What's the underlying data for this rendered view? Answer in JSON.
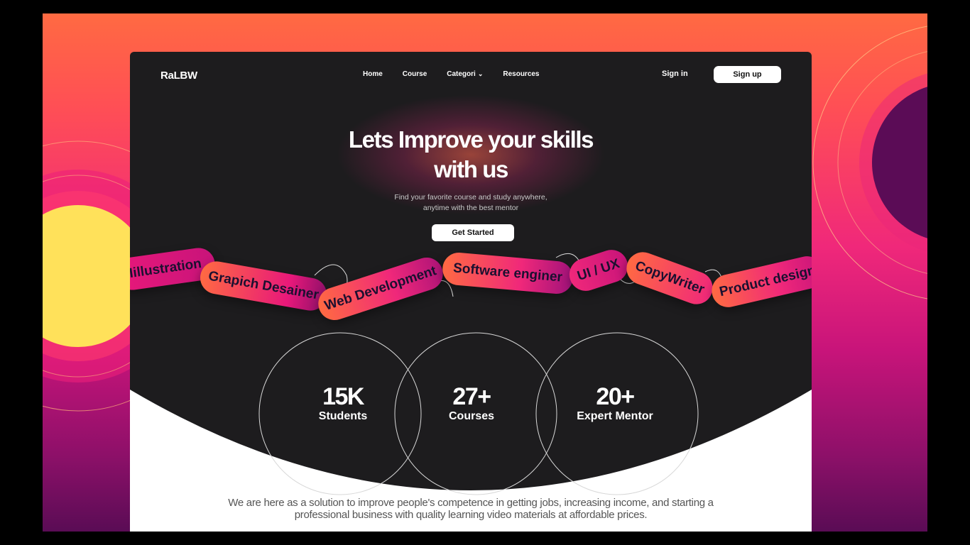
{
  "brand": {
    "logo": "RaLBW"
  },
  "nav": {
    "links": [
      "Home",
      "Course",
      "Categori",
      "Resources"
    ],
    "signin": "Sign in",
    "signup": "Sign up"
  },
  "hero": {
    "title_line1": "Lets Improve your skills",
    "title_line2": "with us",
    "subtitle_line1": "Find your favorite course and study anywhere,",
    "subtitle_line2": "anytime with the best mentor",
    "cta": "Get Started"
  },
  "categories": [
    "Iillustration",
    "Grapich Desainer",
    "Web Development",
    "Software enginer",
    "UI / UX",
    "CopyWriter",
    "Product design"
  ],
  "stats": [
    {
      "value": "15K",
      "label": "Students"
    },
    {
      "value": "27+",
      "label": "Courses"
    },
    {
      "value": "20+",
      "label": "Expert Mentor"
    }
  ],
  "mission": {
    "line1": "We are here as a solution to improve people's competence in getting jobs, increasing income, and starting a",
    "line2": "professional business with quality learning video materials at affordable prices."
  },
  "colors": {
    "accent_orange": "#ff6a42",
    "accent_pink": "#e8187a",
    "dark_bg": "#1d1c1e",
    "accent_yellow": "#ffe15a"
  },
  "icons": {
    "dropdown": "chevron-down-icon"
  }
}
